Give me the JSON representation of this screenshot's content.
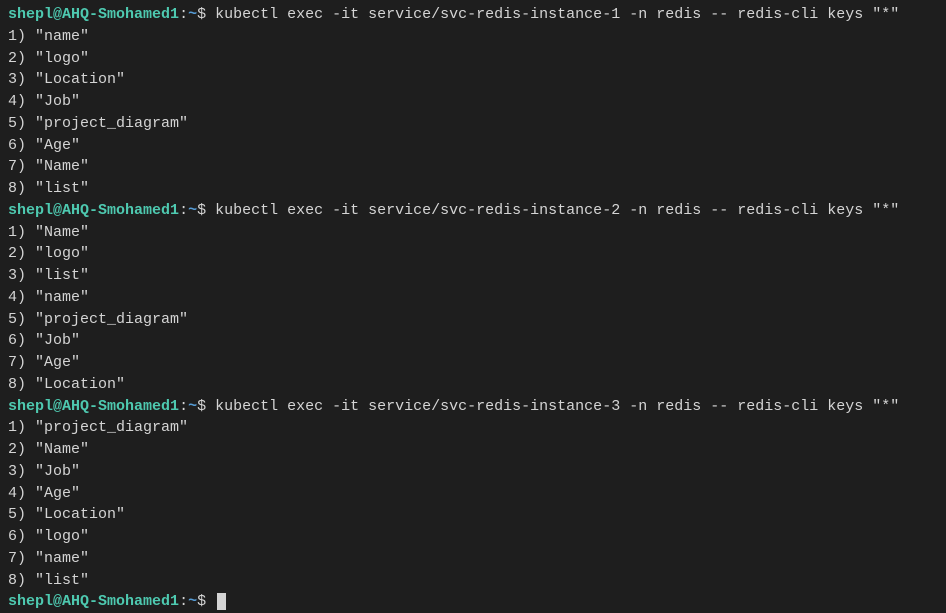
{
  "prompt": {
    "user": "shepl",
    "at": "@",
    "host": "AHQ-Smohamed1",
    "colon": ":",
    "tilde": "~",
    "dollar": "$"
  },
  "commands": {
    "cmd1": "kubectl exec -it service/svc-redis-instance-1 -n redis -- redis-cli keys \"*\"",
    "cmd2": "kubectl exec -it service/svc-redis-instance-2 -n redis -- redis-cli keys \"*\"",
    "cmd3": "kubectl exec -it service/svc-redis-instance-3 -n redis -- redis-cli keys \"*\""
  },
  "output1": {
    "l1": "1) \"name\"",
    "l2": "2) \"logo\"",
    "l3": "3) \"Location\"",
    "l4": "4) \"Job\"",
    "l5": "5) \"project_diagram\"",
    "l6": "6) \"Age\"",
    "l7": "7) \"Name\"",
    "l8": "8) \"list\""
  },
  "output2": {
    "l1": "1) \"Name\"",
    "l2": "2) \"logo\"",
    "l3": "3) \"list\"",
    "l4": "4) \"name\"",
    "l5": "5) \"project_diagram\"",
    "l6": "6) \"Job\"",
    "l7": "7) \"Age\"",
    "l8": "8) \"Location\""
  },
  "output3": {
    "l1": "1) \"project_diagram\"",
    "l2": "2) \"Name\"",
    "l3": "3) \"Job\"",
    "l4": "4) \"Age\"",
    "l5": "5) \"Location\"",
    "l6": "6) \"logo\"",
    "l7": "7) \"name\"",
    "l8": "8) \"list\""
  }
}
